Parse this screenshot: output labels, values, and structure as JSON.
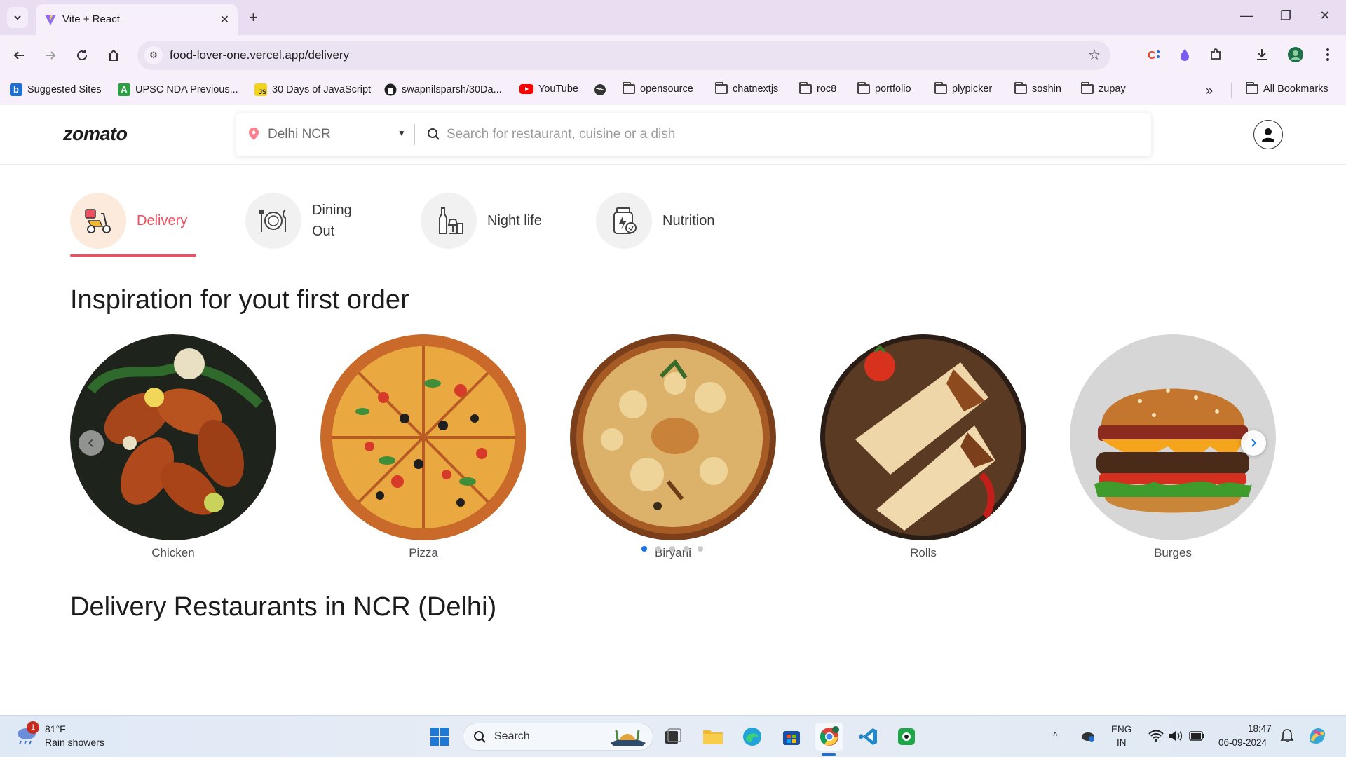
{
  "browser": {
    "tab_title": "Vite + React",
    "url": "food-lover-one.vercel.app/delivery",
    "bookmarks": [
      {
        "label": "Suggested Sites",
        "icon": "bing-icon"
      },
      {
        "label": "UPSC NDA Previous...",
        "icon": "green-a-icon"
      },
      {
        "label": "30 Days of JavaScript",
        "icon": "js-icon"
      },
      {
        "label": "swapnilsparsh/30Da...",
        "icon": "github-icon"
      },
      {
        "label": "YouTube",
        "icon": "youtube-icon"
      },
      {
        "label": "",
        "icon": "globe-icon"
      },
      {
        "label": "opensource",
        "icon": "folder-icon"
      },
      {
        "label": "chatnextjs",
        "icon": "folder-icon"
      },
      {
        "label": "roc8",
        "icon": "folder-icon"
      },
      {
        "label": "portfolio",
        "icon": "folder-icon"
      },
      {
        "label": "plypicker",
        "icon": "folder-icon"
      },
      {
        "label": "soshin",
        "icon": "folder-icon"
      },
      {
        "label": "zupay",
        "icon": "folder-icon"
      }
    ],
    "all_bookmarks": "All Bookmarks"
  },
  "header": {
    "logo": "zomato",
    "location": "Delhi NCR",
    "search_placeholder": "Search for restaurant, cuisine or a dish"
  },
  "categories": [
    {
      "label": "Delivery",
      "icon": "scooter-icon",
      "active": true
    },
    {
      "label": "Dining Out",
      "icon": "dining-icon",
      "active": false
    },
    {
      "label": "Night life",
      "icon": "bottles-icon",
      "active": false
    },
    {
      "label": "Nutrition",
      "icon": "supplement-jar-icon",
      "active": false
    }
  ],
  "inspiration": {
    "title": "Inspiration for yout first order",
    "items": [
      {
        "name": "Chicken"
      },
      {
        "name": "Pizza"
      },
      {
        "name": "Biryani"
      },
      {
        "name": "Rolls"
      },
      {
        "name": "Burges"
      }
    ],
    "dots_count": 5,
    "active_dot": 0
  },
  "restaurants": {
    "title": "Delivery Restaurants in NCR (Delhi)"
  },
  "taskbar": {
    "weather_badge": "1",
    "weather_temp": "81°F",
    "weather_desc": "Rain showers",
    "search_label": "Search",
    "lang_top": "ENG",
    "lang_bottom": "IN",
    "time": "18:47",
    "date": "06-09-2024"
  },
  "colors": {
    "accent": "#ef4f5f",
    "chrome_tab_bar": "#e9ddf2",
    "chrome_toolbar": "#f7f0fb"
  }
}
